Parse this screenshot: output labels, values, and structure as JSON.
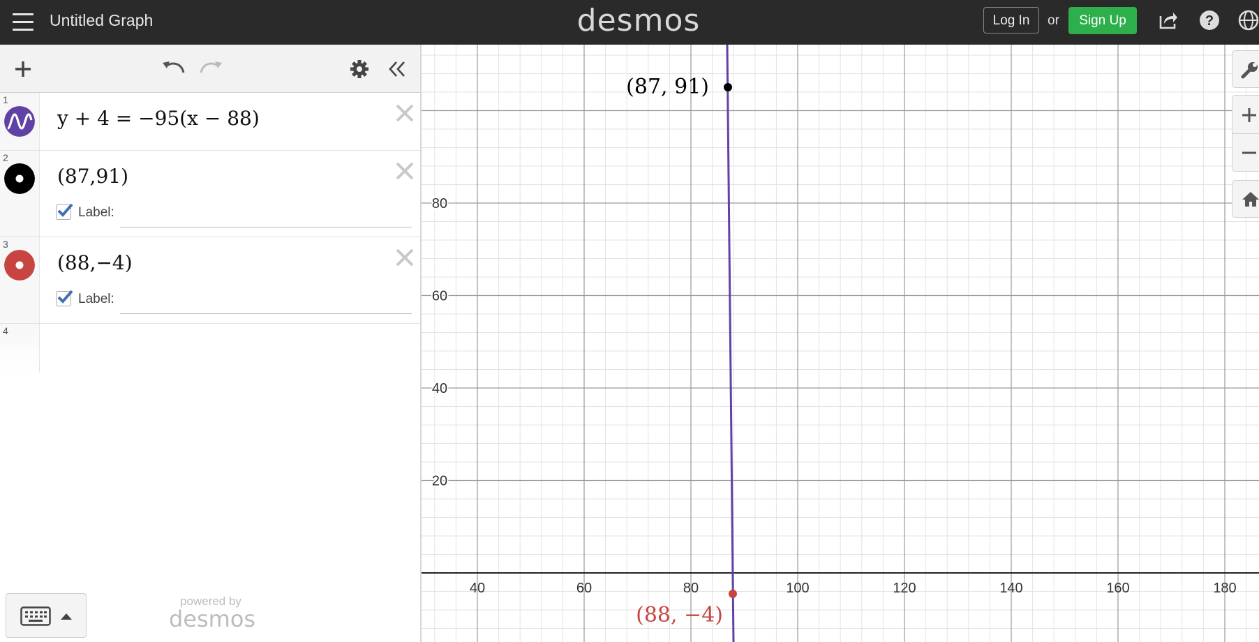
{
  "header": {
    "title": "Untitled Graph",
    "logo": "desmos",
    "login_label": "Log In",
    "or_label": "or",
    "signup_label": "Sign Up",
    "icons": [
      "menu-icon",
      "share-icon",
      "help-icon",
      "globe-icon"
    ]
  },
  "expressions": [
    {
      "num": "1",
      "type": "equation",
      "latex": "y + 4 = −95(x − 88)",
      "color": "#6042a6"
    },
    {
      "num": "2",
      "type": "point",
      "text": "(87,91)",
      "label_text": "Label:",
      "label_checked": true,
      "color": "#000000"
    },
    {
      "num": "3",
      "type": "point",
      "text": "(88,−4)",
      "label_text": "Label:",
      "label_checked": true,
      "color": "#c74440"
    },
    {
      "num": "4",
      "type": "empty"
    }
  ],
  "footer": {
    "powered_by": "powered by",
    "logo": "desmos"
  },
  "graph": {
    "x_ticks": [
      "40",
      "60",
      "80",
      "100",
      "120",
      "140",
      "160",
      "180"
    ],
    "y_ticks": [
      "80",
      "60",
      "40",
      "20"
    ],
    "point_labels": [
      "(87, 91)",
      "(88, −4)"
    ],
    "line_color": "#6042a6",
    "point_colors": [
      "#000000",
      "#c74440"
    ]
  }
}
